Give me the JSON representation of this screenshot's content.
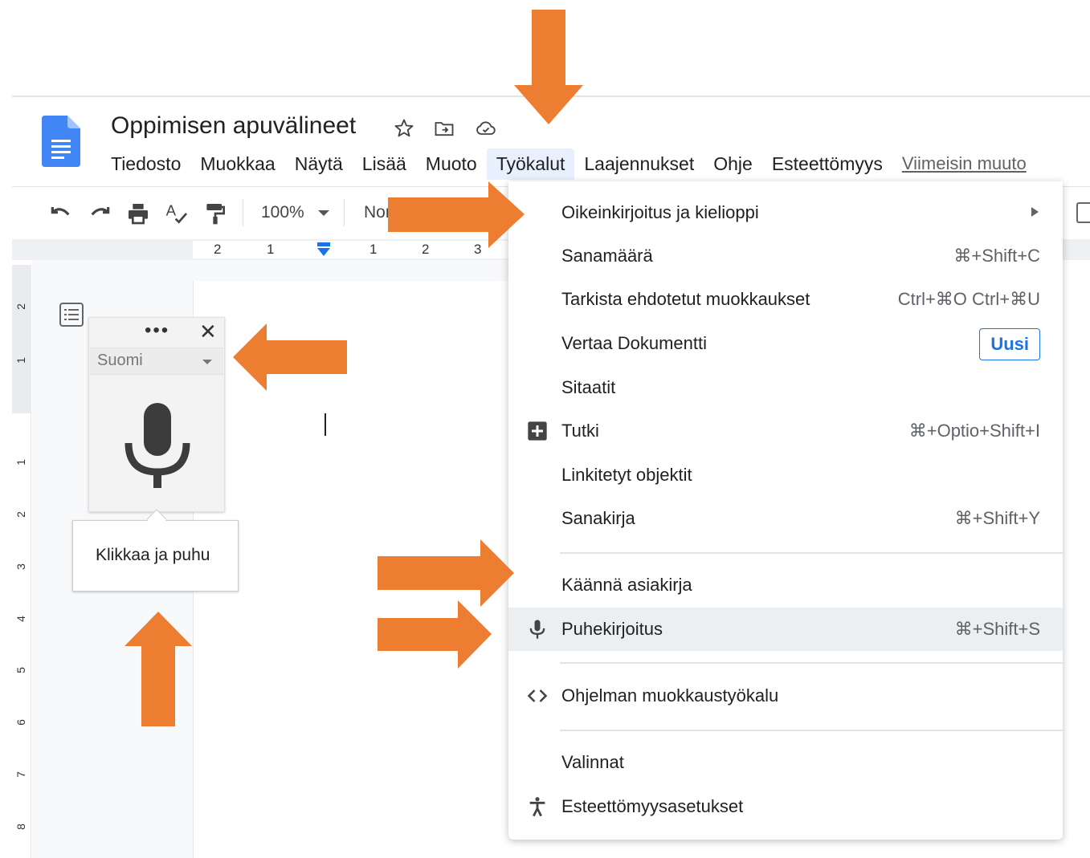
{
  "document": {
    "title": "Oppimisen apuvälineet"
  },
  "menubar": {
    "items": [
      {
        "label": "Tiedosto"
      },
      {
        "label": "Muokkaa"
      },
      {
        "label": "Näytä"
      },
      {
        "label": "Lisää"
      },
      {
        "label": "Muoto"
      },
      {
        "label": "Työkalut"
      },
      {
        "label": "Laajennukset"
      },
      {
        "label": "Ohje"
      },
      {
        "label": "Esteettömyys"
      }
    ],
    "last_edit_link": "Viimeisin muuto"
  },
  "toolbar": {
    "zoom": "100%",
    "style": "Nor"
  },
  "ruler": {
    "numbers": [
      "2",
      "1",
      "1",
      "2",
      "3"
    ]
  },
  "vruler": {
    "numbers": [
      "2",
      "1",
      "1",
      "2",
      "3",
      "4",
      "5",
      "6",
      "7",
      "8"
    ]
  },
  "voice_widget": {
    "more": "•••",
    "close": "✕",
    "language": "Suomi",
    "tooltip": "Klikkaa ja puhu"
  },
  "tools_menu": {
    "items": [
      {
        "label": "Oikeinkirjoitus ja kielioppi",
        "shortcut": "",
        "submenu": true
      },
      {
        "label": "Sanamäärä",
        "shortcut": "⌘+Shift+C"
      },
      {
        "label": "Tarkista ehdotetut muokkaukset",
        "shortcut": "Ctrl+⌘O Ctrl+⌘U"
      },
      {
        "label": "Vertaa Dokumentti",
        "badge": "Uusi"
      },
      {
        "label": "Sitaatit",
        "shortcut": ""
      },
      {
        "label": "Tutki",
        "shortcut": "⌘+Optio+Shift+I",
        "icon": "explore-icon"
      },
      {
        "label": "Linkitetyt objektit",
        "shortcut": ""
      },
      {
        "label": "Sanakirja",
        "shortcut": "⌘+Shift+Y"
      },
      {
        "label": "Käännä asiakirja",
        "shortcut": ""
      },
      {
        "label": "Puhekirjoitus",
        "shortcut": "⌘+Shift+S",
        "icon": "microphone-icon"
      },
      {
        "label": "Ohjelman muokkaustyökalu",
        "shortcut": "",
        "icon": "code-icon"
      },
      {
        "label": "Valinnat",
        "shortcut": ""
      },
      {
        "label": "Esteettömyysasetukset",
        "shortcut": "",
        "icon": "accessibility-icon"
      }
    ]
  },
  "colors": {
    "arrow": "#ed7d31",
    "docs_blue": "#4285f4",
    "menu_active_bg": "#e8f0fe",
    "badge_blue": "#1a73e8",
    "hover_bg": "#eceff1"
  }
}
